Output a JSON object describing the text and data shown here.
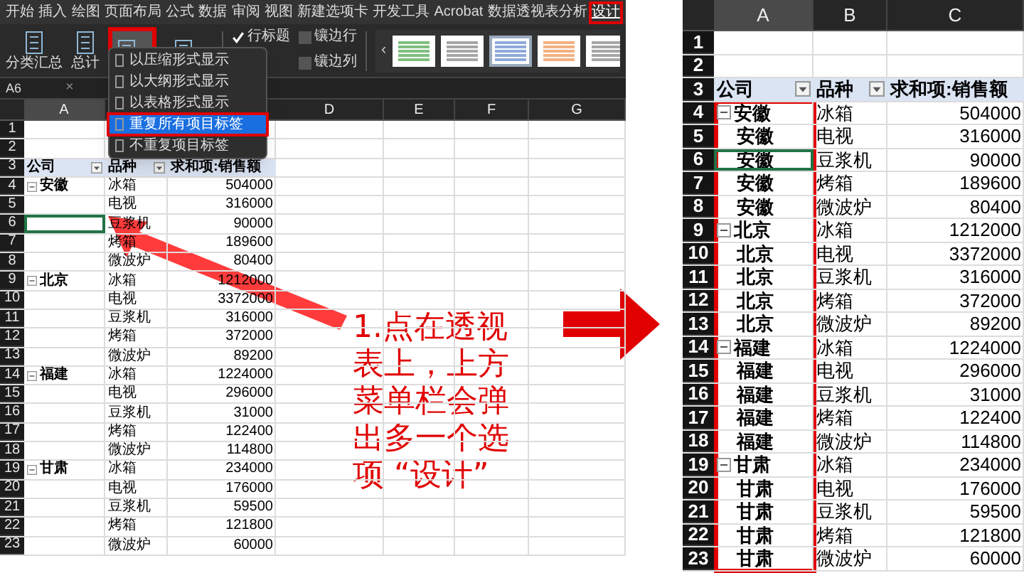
{
  "ribbon": {
    "tabs": [
      {
        "label": "开始",
        "selected": false
      },
      {
        "label": "插入",
        "selected": false
      },
      {
        "label": "绘图",
        "selected": false
      },
      {
        "label": "页面布局",
        "selected": false
      },
      {
        "label": "公式",
        "selected": false
      },
      {
        "label": "数据",
        "selected": false
      },
      {
        "label": "审阅",
        "selected": false
      },
      {
        "label": "视图",
        "selected": false
      },
      {
        "label": "新建选项卡",
        "selected": false
      },
      {
        "label": "开发工具",
        "selected": false
      },
      {
        "label": "Acrobat",
        "selected": false
      },
      {
        "label": "数据透视表分析",
        "selected": false
      },
      {
        "label": "设计",
        "selected": true
      }
    ],
    "tools": [
      {
        "kind": "labeled",
        "label": "分类汇总"
      },
      {
        "kind": "labeled",
        "label": "总计"
      },
      {
        "kind": "icon",
        "highlighted": true
      },
      {
        "kind": "icon",
        "highlighted": false
      }
    ],
    "options": [
      {
        "label": "行标题",
        "checked": true
      },
      {
        "label": "镶边行",
        "checked": false
      },
      {
        "label": "镶边列",
        "checked": false
      }
    ],
    "gallery": {
      "scroll": "‹",
      "styles": [
        {
          "color": "#7fbf7f",
          "selected": false
        },
        {
          "color": "#a6a6a6",
          "selected": false
        },
        {
          "color": "#8ea9db",
          "selected": true
        },
        {
          "color": "#f4b183",
          "selected": false
        },
        {
          "color": "#a6a6a6",
          "selected": false
        }
      ]
    }
  },
  "menu": {
    "items": [
      {
        "label": "以压缩形式显示",
        "selected": false
      },
      {
        "label": "以大纲形式显示",
        "selected": false
      },
      {
        "label": "以表格形式显示",
        "selected": false
      },
      {
        "label": "重复所有项目标签",
        "selected": true
      },
      {
        "label": "不重复项目标签",
        "selected": false
      }
    ]
  },
  "formula_bar": {
    "name_box": "A6",
    "cancel": "×"
  },
  "left_sheet": {
    "columns": [
      "A",
      "D",
      "E",
      "F",
      "G"
    ],
    "row_numbers": [
      "1",
      "2",
      "3",
      "4",
      "5",
      "6",
      "7",
      "8",
      "9",
      "10",
      "11",
      "12",
      "13",
      "14",
      "15",
      "16",
      "17",
      "18",
      "19",
      "20",
      "21",
      "22",
      "23"
    ],
    "header": [
      "公司",
      "品种",
      "求和项:销售额"
    ],
    "groups": [
      {
        "company": "安徽",
        "expanded": true,
        "rows": [
          {
            "product": "冰箱",
            "amount": "504000",
            "selected": false
          },
          {
            "product": "电视",
            "amount": "316000",
            "selected": false
          },
          {
            "product": "豆浆机",
            "amount": "90000",
            "selected": true
          },
          {
            "product": "烤箱",
            "amount": "189600",
            "selected": false
          },
          {
            "product": "微波炉",
            "amount": "80400",
            "selected": false
          }
        ]
      },
      {
        "company": "北京",
        "expanded": true,
        "rows": [
          {
            "product": "冰箱",
            "amount": "1212000",
            "selected": false
          },
          {
            "product": "电视",
            "amount": "3372000",
            "selected": false
          },
          {
            "product": "豆浆机",
            "amount": "316000",
            "selected": false
          },
          {
            "product": "烤箱",
            "amount": "372000",
            "selected": false
          },
          {
            "product": "微波炉",
            "amount": "89200",
            "selected": false
          }
        ]
      },
      {
        "company": "福建",
        "expanded": true,
        "rows": [
          {
            "product": "冰箱",
            "amount": "1224000",
            "selected": false
          },
          {
            "product": "电视",
            "amount": "296000",
            "selected": false
          },
          {
            "product": "豆浆机",
            "amount": "31000",
            "selected": false
          },
          {
            "product": "烤箱",
            "amount": "122400",
            "selected": false
          },
          {
            "product": "微波炉",
            "amount": "114800",
            "selected": false
          }
        ]
      },
      {
        "company": "甘肃",
        "expanded": true,
        "rows": [
          {
            "product": "冰箱",
            "amount": "234000",
            "selected": false
          },
          {
            "product": "电视",
            "amount": "176000",
            "selected": false
          },
          {
            "product": "豆浆机",
            "amount": "59500",
            "selected": false
          },
          {
            "product": "烤箱",
            "amount": "121800",
            "selected": false
          },
          {
            "product": "微波炉",
            "amount": "60000",
            "selected": false
          }
        ]
      }
    ]
  },
  "annotation": {
    "lines": [
      "1.点在透视",
      "表上，上方",
      "菜单栏会弹",
      "出多一个选",
      "项 “设计”"
    ]
  },
  "right_sheet": {
    "columns": [
      "A",
      "B",
      "C"
    ],
    "row_numbers": [
      "1",
      "2",
      "3",
      "4",
      "5",
      "6",
      "7",
      "8",
      "9",
      "10",
      "11",
      "12",
      "13",
      "14",
      "15",
      "16",
      "17",
      "18",
      "19",
      "20",
      "21",
      "22",
      "23"
    ],
    "header": [
      "公司",
      "品种",
      "求和项:销售额"
    ],
    "groups": [
      {
        "company": "安徽",
        "expanded": true,
        "rows": [
          {
            "product": "冰箱",
            "amount": "504000",
            "selected": false
          },
          {
            "company": "安徽",
            "product": "电视",
            "amount": "316000",
            "selected": false
          },
          {
            "company": "安徽",
            "product": "豆浆机",
            "amount": "90000",
            "selected": true
          },
          {
            "company": "安徽",
            "product": "烤箱",
            "amount": "189600",
            "selected": false
          },
          {
            "company": "安徽",
            "product": "微波炉",
            "amount": "80400",
            "selected": false
          }
        ]
      },
      {
        "company": "北京",
        "expanded": true,
        "rows": [
          {
            "product": "冰箱",
            "amount": "1212000",
            "selected": false
          },
          {
            "company": "北京",
            "product": "电视",
            "amount": "3372000",
            "selected": false
          },
          {
            "company": "北京",
            "product": "豆浆机",
            "amount": "316000",
            "selected": false
          },
          {
            "company": "北京",
            "product": "烤箱",
            "amount": "372000",
            "selected": false
          },
          {
            "company": "北京",
            "product": "微波炉",
            "amount": "89200",
            "selected": false
          }
        ]
      },
      {
        "company": "福建",
        "expanded": true,
        "rows": [
          {
            "product": "冰箱",
            "amount": "1224000",
            "selected": false
          },
          {
            "company": "福建",
            "product": "电视",
            "amount": "296000",
            "selected": false
          },
          {
            "company": "福建",
            "product": "豆浆机",
            "amount": "31000",
            "selected": false
          },
          {
            "company": "福建",
            "product": "烤箱",
            "amount": "122400",
            "selected": false
          },
          {
            "company": "福建",
            "product": "微波炉",
            "amount": "114800",
            "selected": false
          }
        ]
      },
      {
        "company": "甘肃",
        "expanded": true,
        "rows": [
          {
            "product": "冰箱",
            "amount": "234000",
            "selected": false
          },
          {
            "company": "甘肃",
            "product": "电视",
            "amount": "176000",
            "selected": false
          },
          {
            "company": "甘肃",
            "product": "豆浆机",
            "amount": "59500",
            "selected": false
          },
          {
            "company": "甘肃",
            "product": "烤箱",
            "amount": "121800",
            "selected": false
          },
          {
            "company": "甘肃",
            "product": "微波炉",
            "amount": "60000",
            "selected": false
          }
        ]
      }
    ]
  }
}
